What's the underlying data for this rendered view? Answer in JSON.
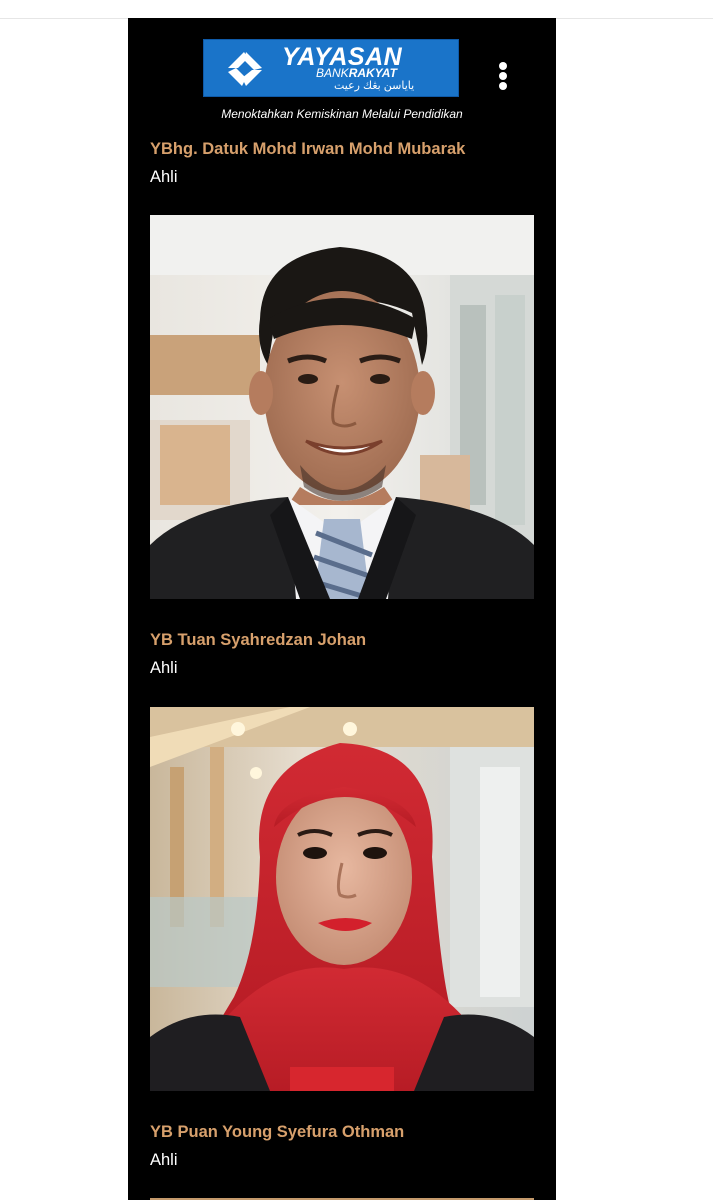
{
  "header": {
    "logo_name": "YAYASAN",
    "logo_sub_prefix": "BANK",
    "logo_sub_bold": "RAKYAT",
    "logo_jawi": "ياياسن بڠك رعيت",
    "tagline": "Menoktahkan Kemiskinan Melalui Pendidikan",
    "menu_icon": "vertical-dots-icon"
  },
  "members": [
    {
      "name": "YBhg. Datuk Mohd Irwan Mohd Mubarak",
      "role": "Ahli"
    },
    {
      "name": "YB Tuan Syahredzan Johan",
      "role": "Ahli"
    },
    {
      "name": "YB Puan Young Syefura Othman",
      "role": "Ahli"
    }
  ],
  "colors": {
    "background": "#000000",
    "name_accent": "#d7a06c",
    "logo_blue": "#1a74c9"
  }
}
